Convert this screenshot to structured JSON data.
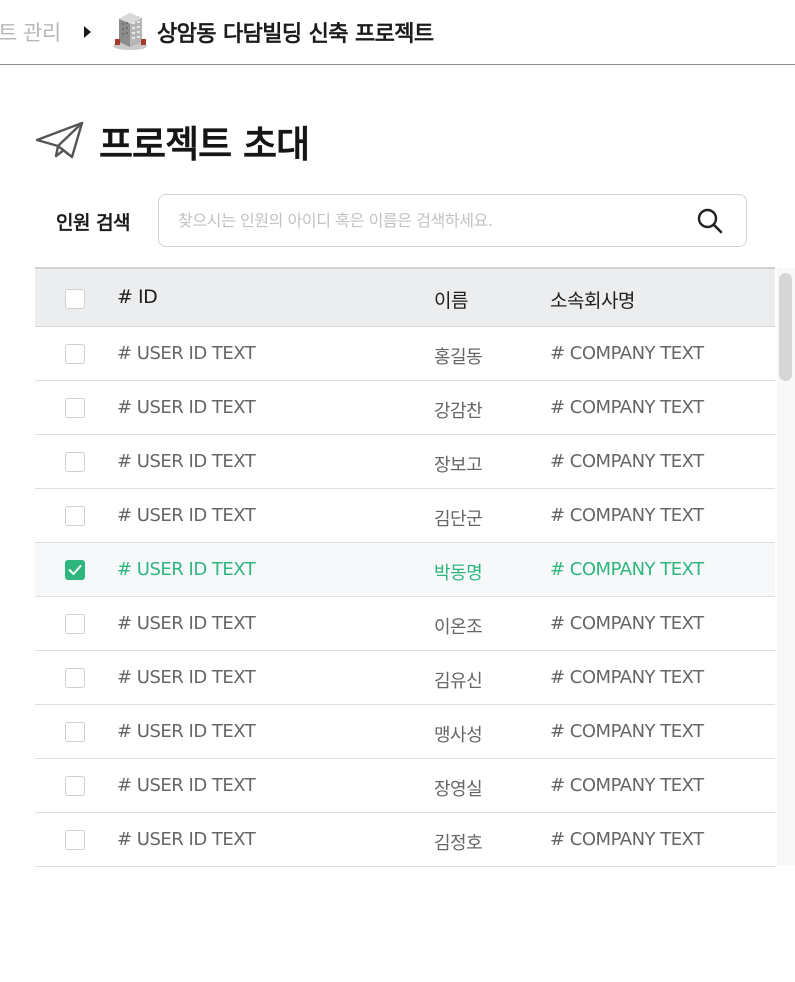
{
  "breadcrumb": {
    "previous": "트 관리",
    "current": "상암동 다담빌딩 신축 프로젝트",
    "building_icon": "building-icon",
    "arrow_icon": "caret-right-icon"
  },
  "page": {
    "title": "프로젝트 초대",
    "title_icon": "paper-plane-icon"
  },
  "search": {
    "label": "인원 검색",
    "placeholder": "찾으시는 인원의 아이디 혹은 이름은 검색하세요.",
    "value": "",
    "icon": "search-icon"
  },
  "table": {
    "headers": {
      "id": "# ID",
      "name": "이름",
      "company": "소속회사명"
    },
    "rows": [
      {
        "id": "# USER ID TEXT",
        "name": "홍길동",
        "company": "# COMPANY TEXT",
        "checked": false
      },
      {
        "id": "# USER ID TEXT",
        "name": "강감찬",
        "company": "# COMPANY TEXT",
        "checked": false
      },
      {
        "id": "# USER ID TEXT",
        "name": "장보고",
        "company": "# COMPANY TEXT",
        "checked": false
      },
      {
        "id": "# USER ID TEXT",
        "name": "김단군",
        "company": "# COMPANY TEXT",
        "checked": false
      },
      {
        "id": "# USER ID TEXT",
        "name": "박동명",
        "company": "# COMPANY TEXT",
        "checked": true
      },
      {
        "id": "# USER ID TEXT",
        "name": "이온조",
        "company": "# COMPANY TEXT",
        "checked": false
      },
      {
        "id": "# USER ID TEXT",
        "name": "김유신",
        "company": "# COMPANY TEXT",
        "checked": false
      },
      {
        "id": "# USER ID TEXT",
        "name": "맹사성",
        "company": "# COMPANY TEXT",
        "checked": false
      },
      {
        "id": "# USER ID TEXT",
        "name": "장영실",
        "company": "# COMPANY TEXT",
        "checked": false
      },
      {
        "id": "# USER ID TEXT",
        "name": "김정호",
        "company": "# COMPANY TEXT",
        "checked": false
      }
    ]
  },
  "colors": {
    "accent": "#2eb67d",
    "header_bg": "#ecedef",
    "text_muted": "#666666",
    "border": "#dedede"
  }
}
